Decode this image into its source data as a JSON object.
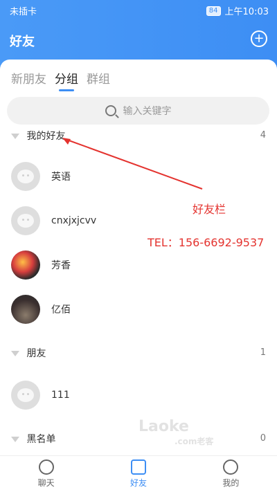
{
  "status": {
    "carrier": "未插卡",
    "battery": "84",
    "time": "上午10:03"
  },
  "header": {
    "title": "好友"
  },
  "tabs": [
    {
      "label": "新朋友"
    },
    {
      "label": "分组"
    },
    {
      "label": "群组"
    }
  ],
  "search": {
    "placeholder": "输入关键字"
  },
  "groups": [
    {
      "name": "我的好友",
      "count": "4",
      "members": [
        {
          "name": "英语"
        },
        {
          "name": "cnxjxjcvv"
        },
        {
          "name": "芳香"
        },
        {
          "name": "亿佰"
        }
      ]
    },
    {
      "name": "朋友",
      "count": "1",
      "members": [
        {
          "name": "111"
        }
      ]
    },
    {
      "name": "黑名单",
      "count": "0",
      "members": []
    }
  ],
  "annotation": {
    "label": "好友栏",
    "tel": "TEL：156-6692-9537",
    "color": "#e4332f"
  },
  "watermark": {
    "brand": "Laoke",
    "sub": ".com老客"
  },
  "bottom_nav": [
    {
      "label": "聊天"
    },
    {
      "label": "好友"
    },
    {
      "label": "我的"
    }
  ],
  "theme": {
    "primary": "#3d8ef4"
  }
}
